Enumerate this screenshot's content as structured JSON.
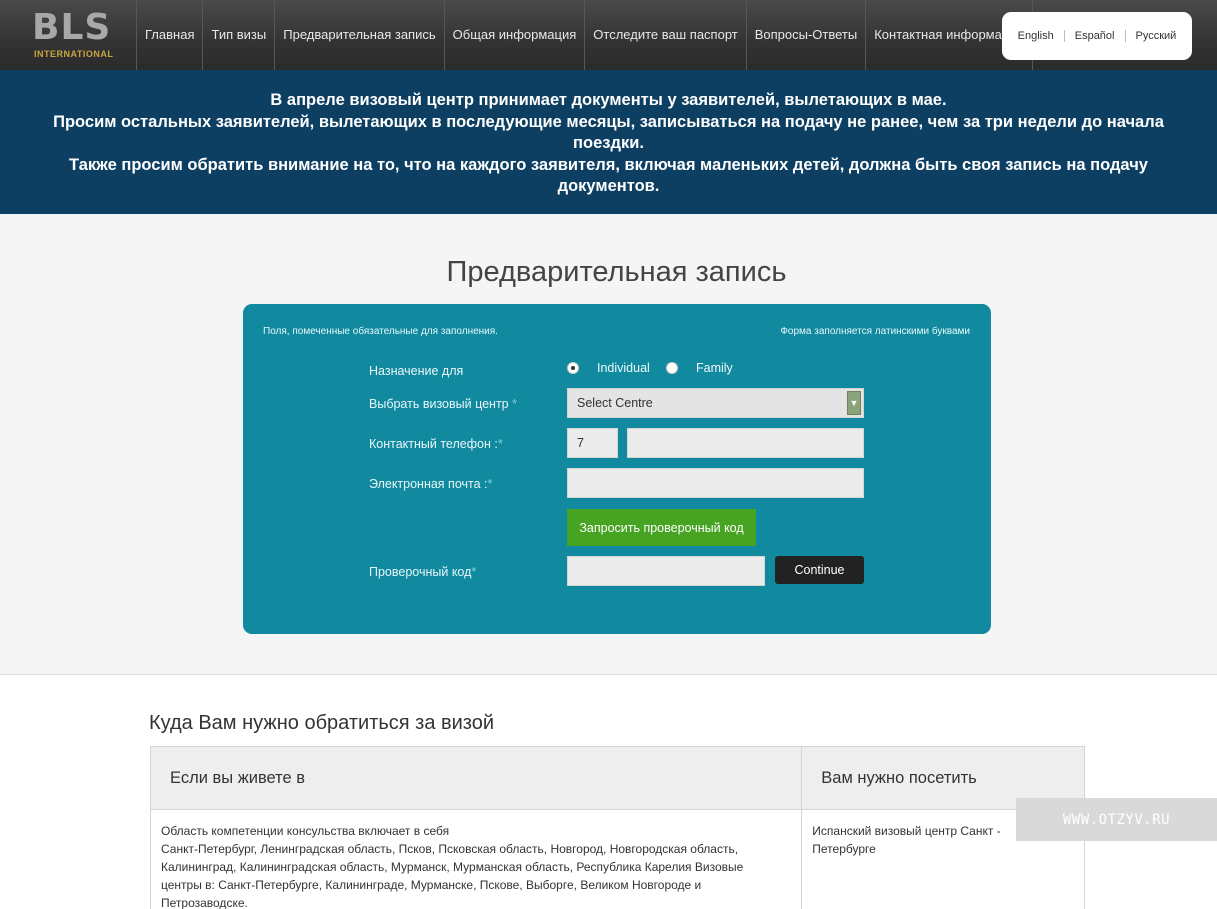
{
  "header": {
    "logo": "BLS",
    "logo_sub": "INTERNATIONAL",
    "nav": [
      "Главная",
      "Тип визы",
      "Предварительная запись",
      "Общая информация",
      "Отследите ваш паспорт",
      "Вопросы-Ответы",
      "Контактная информация"
    ],
    "languages": [
      "English",
      "Español",
      "Русский"
    ]
  },
  "announcement": {
    "lines": [
      "В апреле визовый центр принимает документы у заявителей, вылетающих в мае.",
      "Просим остальных заявителей, вылетающих в последующие месяцы, записываться на подачу не ранее, чем за три недели до начала поездки.",
      "Также просим обратить внимание на то, что на каждого заявителя, включая маленьких детей, должна быть своя запись на подачу документов."
    ]
  },
  "form": {
    "title": "Предварительная запись",
    "note_required": "Поля, помеченные   обязательные для заполнения.",
    "note_latin": "Форма заполняется латинскими буквами",
    "purpose_label": "Назначение для",
    "option_individual": "Individual",
    "option_family": "Family",
    "centre_label": "Выбрать визовый центр",
    "centre_value": "Select Centre",
    "phone_label": "Контактный телефон :",
    "phone_code": "7",
    "phone_number": "",
    "email_label": "Электронная почта :",
    "email_value": "",
    "request_code_button": "Запросить проверочный код",
    "code_label": "Проверочный код",
    "code_value": "",
    "continue_button": "Continue",
    "required_mark": "*"
  },
  "visa_info": {
    "heading": "Куда Вам нужно обратиться за визой",
    "col1_header": "Если вы живете в",
    "col2_header": "Вам нужно посетить",
    "row1_col1_lines": [
      "Область компетенции консульства включает в себя",
      "Санкт-Петербург, Ленинградская область, Псков, Псковская область, Новгород, Новгородская область,",
      "Калининград, Калининградская область, Мурманск, Мурманская область, Республика Карелия Визовые",
      "центры в: Санкт-Петербурге, Калининграде, Мурманске, Пскове, Выборге, Великом Новгороде и",
      "Петрозаводске."
    ],
    "row1_col2_lines": [
      "Испанский визовый центр Санкт -",
      "Петербурге"
    ]
  },
  "watermark": "WWW.OTZYV.RU"
}
